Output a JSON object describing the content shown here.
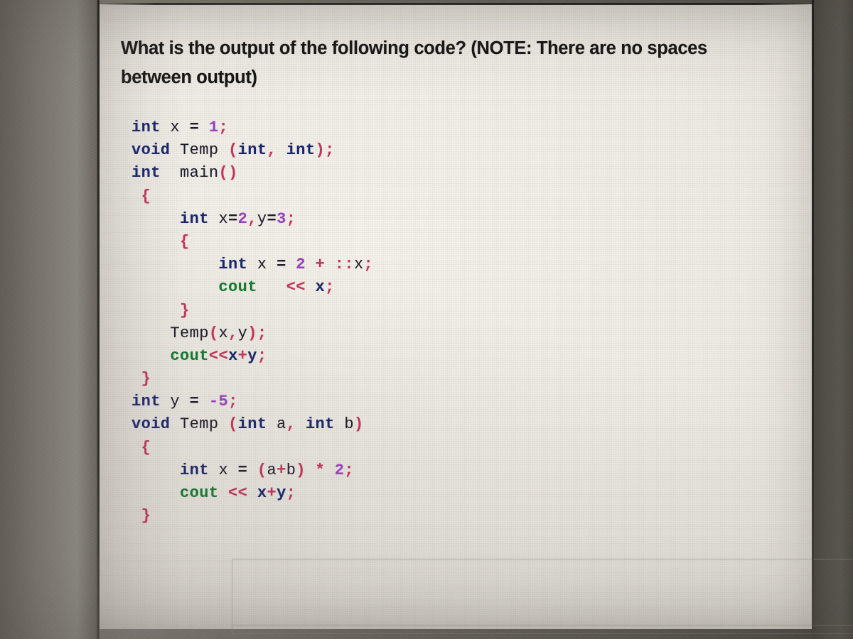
{
  "question": {
    "line1": "What is the output of the following code? (NOTE: There are no spaces",
    "line2": "between output)"
  },
  "code": {
    "language": "C++",
    "lines": [
      {
        "indent": 0,
        "tokens": [
          {
            "t": "int",
            "c": "kw"
          },
          {
            "t": " ",
            "c": "sp"
          },
          {
            "t": "x",
            "c": "id"
          },
          {
            "t": " ",
            "c": "sp"
          },
          {
            "t": "=",
            "c": "op"
          },
          {
            "t": " ",
            "c": "sp"
          },
          {
            "t": "1",
            "c": "num"
          },
          {
            "t": ";",
            "c": "pn"
          }
        ]
      },
      {
        "indent": 0,
        "tokens": [
          {
            "t": "void",
            "c": "kw"
          },
          {
            "t": " ",
            "c": "sp"
          },
          {
            "t": "Temp",
            "c": "id"
          },
          {
            "t": " ",
            "c": "sp"
          },
          {
            "t": "(",
            "c": "pn"
          },
          {
            "t": "int",
            "c": "kw"
          },
          {
            "t": ",",
            "c": "pn"
          },
          {
            "t": " ",
            "c": "sp"
          },
          {
            "t": "int",
            "c": "kw"
          },
          {
            "t": ")",
            "c": "pn"
          },
          {
            "t": ";",
            "c": "pn"
          }
        ]
      },
      {
        "indent": 0,
        "tokens": [
          {
            "t": "int",
            "c": "kw"
          },
          {
            "t": "  ",
            "c": "sp"
          },
          {
            "t": "main",
            "c": "id"
          },
          {
            "t": "(",
            "c": "pn"
          },
          {
            "t": ")",
            "c": "pn"
          }
        ]
      },
      {
        "indent": 0,
        "tokens": [
          {
            "t": " ",
            "c": "sp"
          },
          {
            "t": "{",
            "c": "pn"
          }
        ]
      },
      {
        "indent": 0,
        "tokens": [
          {
            "t": "     ",
            "c": "sp"
          },
          {
            "t": "int",
            "c": "kw"
          },
          {
            "t": " ",
            "c": "sp"
          },
          {
            "t": "x",
            "c": "id"
          },
          {
            "t": "=",
            "c": "op"
          },
          {
            "t": "2",
            "c": "num"
          },
          {
            "t": ",",
            "c": "pn"
          },
          {
            "t": "y",
            "c": "id"
          },
          {
            "t": "=",
            "c": "op"
          },
          {
            "t": "3",
            "c": "num"
          },
          {
            "t": ";",
            "c": "pn"
          }
        ]
      },
      {
        "indent": 0,
        "tokens": [
          {
            "t": "     ",
            "c": "sp"
          },
          {
            "t": "{",
            "c": "pn"
          }
        ]
      },
      {
        "indent": 0,
        "tokens": [
          {
            "t": "         ",
            "c": "sp"
          },
          {
            "t": "int",
            "c": "kw"
          },
          {
            "t": " ",
            "c": "sp"
          },
          {
            "t": "x",
            "c": "id"
          },
          {
            "t": " ",
            "c": "sp"
          },
          {
            "t": "=",
            "c": "op"
          },
          {
            "t": " ",
            "c": "sp"
          },
          {
            "t": "2",
            "c": "num"
          },
          {
            "t": " ",
            "c": "sp"
          },
          {
            "t": "+",
            "c": "opr"
          },
          {
            "t": " ",
            "c": "sp"
          },
          {
            "t": "::",
            "c": "pn"
          },
          {
            "t": "x",
            "c": "id"
          },
          {
            "t": ";",
            "c": "pn"
          }
        ]
      },
      {
        "indent": 0,
        "tokens": [
          {
            "t": "         ",
            "c": "sp"
          },
          {
            "t": "cout",
            "c": "std"
          },
          {
            "t": "   ",
            "c": "sp"
          },
          {
            "t": "<<",
            "c": "opr"
          },
          {
            "t": " ",
            "c": "sp"
          },
          {
            "t": "x",
            "c": "idb"
          },
          {
            "t": ";",
            "c": "pn"
          }
        ]
      },
      {
        "indent": 0,
        "tokens": [
          {
            "t": "     ",
            "c": "sp"
          },
          {
            "t": "}",
            "c": "pn"
          }
        ]
      },
      {
        "indent": 0,
        "tokens": [
          {
            "t": "    ",
            "c": "sp"
          },
          {
            "t": "Temp",
            "c": "id"
          },
          {
            "t": "(",
            "c": "pn"
          },
          {
            "t": "x",
            "c": "id"
          },
          {
            "t": ",",
            "c": "pn"
          },
          {
            "t": "y",
            "c": "id"
          },
          {
            "t": ")",
            "c": "pn"
          },
          {
            "t": ";",
            "c": "pn"
          }
        ]
      },
      {
        "indent": 0,
        "tokens": [
          {
            "t": "    ",
            "c": "sp"
          },
          {
            "t": "cout",
            "c": "std"
          },
          {
            "t": "<<",
            "c": "opr"
          },
          {
            "t": "x",
            "c": "idb"
          },
          {
            "t": "+",
            "c": "opr"
          },
          {
            "t": "y",
            "c": "idb"
          },
          {
            "t": ";",
            "c": "pn"
          }
        ]
      },
      {
        "indent": 0,
        "tokens": [
          {
            "t": " ",
            "c": "sp"
          },
          {
            "t": "}",
            "c": "pn"
          }
        ]
      },
      {
        "indent": 0,
        "tokens": [
          {
            "t": "int",
            "c": "kw"
          },
          {
            "t": " ",
            "c": "sp"
          },
          {
            "t": "y",
            "c": "id"
          },
          {
            "t": " ",
            "c": "sp"
          },
          {
            "t": "=",
            "c": "op"
          },
          {
            "t": " ",
            "c": "sp"
          },
          {
            "t": "-5",
            "c": "num"
          },
          {
            "t": ";",
            "c": "pn"
          }
        ]
      },
      {
        "indent": 0,
        "tokens": [
          {
            "t": "void",
            "c": "kw"
          },
          {
            "t": " ",
            "c": "sp"
          },
          {
            "t": "Temp",
            "c": "id"
          },
          {
            "t": " ",
            "c": "sp"
          },
          {
            "t": "(",
            "c": "pn"
          },
          {
            "t": "int",
            "c": "kw"
          },
          {
            "t": " ",
            "c": "sp"
          },
          {
            "t": "a",
            "c": "id"
          },
          {
            "t": ",",
            "c": "pn"
          },
          {
            "t": " ",
            "c": "sp"
          },
          {
            "t": "int",
            "c": "kw"
          },
          {
            "t": " ",
            "c": "sp"
          },
          {
            "t": "b",
            "c": "id"
          },
          {
            "t": ")",
            "c": "pn"
          }
        ]
      },
      {
        "indent": 0,
        "tokens": [
          {
            "t": " ",
            "c": "sp"
          },
          {
            "t": "{",
            "c": "pn"
          }
        ]
      },
      {
        "indent": 0,
        "tokens": [
          {
            "t": "     ",
            "c": "sp"
          },
          {
            "t": "int",
            "c": "kw"
          },
          {
            "t": " ",
            "c": "sp"
          },
          {
            "t": "x",
            "c": "id"
          },
          {
            "t": " ",
            "c": "sp"
          },
          {
            "t": "=",
            "c": "op"
          },
          {
            "t": " ",
            "c": "sp"
          },
          {
            "t": "(",
            "c": "pn"
          },
          {
            "t": "a",
            "c": "id"
          },
          {
            "t": "+",
            "c": "opr"
          },
          {
            "t": "b",
            "c": "id"
          },
          {
            "t": ")",
            "c": "pn"
          },
          {
            "t": " ",
            "c": "sp"
          },
          {
            "t": "*",
            "c": "opr"
          },
          {
            "t": " ",
            "c": "sp"
          },
          {
            "t": "2",
            "c": "num"
          },
          {
            "t": ";",
            "c": "pn"
          }
        ]
      },
      {
        "indent": 0,
        "tokens": [
          {
            "t": "     ",
            "c": "sp"
          },
          {
            "t": "cout",
            "c": "std"
          },
          {
            "t": " ",
            "c": "sp"
          },
          {
            "t": "<<",
            "c": "opr"
          },
          {
            "t": " ",
            "c": "sp"
          },
          {
            "t": "x",
            "c": "idb"
          },
          {
            "t": "+",
            "c": "opr"
          },
          {
            "t": "y",
            "c": "idb"
          },
          {
            "t": ";",
            "c": "pn"
          }
        ]
      },
      {
        "indent": 0,
        "tokens": [
          {
            "t": " ",
            "c": "sp"
          },
          {
            "t": "}",
            "c": "pn"
          }
        ]
      }
    ],
    "plain_text": "int x = 1;\nvoid Temp (int, int);\nint  main()\n {\n     int x=2,y=3;\n     {\n         int x = 2 + ::x;\n         cout   << x;\n     }\n    Temp(x,y);\n    cout<<x+y;\n }\nint y = -5;\nvoid Temp (int a, int b)\n {\n     int x = (a+b) * 2;\n     cout << x+y;\n }"
  },
  "colors": {
    "keyword": "#17246e",
    "identifier": "#1b1b2a",
    "number": "#9b3fc4",
    "punctuation": "#c7315a",
    "operator": "#c7315a",
    "stream": "#0f7a2e",
    "question_text": "#171717",
    "paper": "#efebe5",
    "surround": "#7c7870"
  }
}
